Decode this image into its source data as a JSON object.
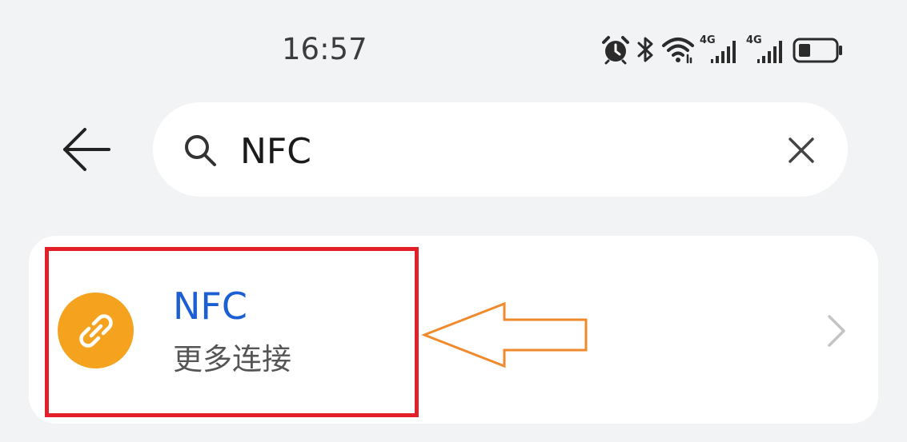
{
  "status_bar": {
    "time": "16:57",
    "signal_1_label": "4G",
    "signal_2_label": "4G",
    "icons": [
      "alarm-icon",
      "bluetooth-icon",
      "wifi-icon",
      "signal-4g-icon",
      "signal-4g-icon",
      "battery-icon"
    ]
  },
  "search": {
    "value": "NFC",
    "back_icon": "arrow-left-icon",
    "search_icon": "search-icon",
    "clear_icon": "close-icon"
  },
  "results": [
    {
      "title": "NFC",
      "subtitle": "更多连接",
      "icon": "link-icon",
      "icon_color": "#f5a21f",
      "chevron_icon": "chevron-right-icon"
    }
  ],
  "annotations": {
    "highlight_color": "#e3202a",
    "arrow_color": "#f08a2c"
  },
  "colors": {
    "background": "#f1f3f5",
    "title_accent": "#1c5fd2"
  }
}
